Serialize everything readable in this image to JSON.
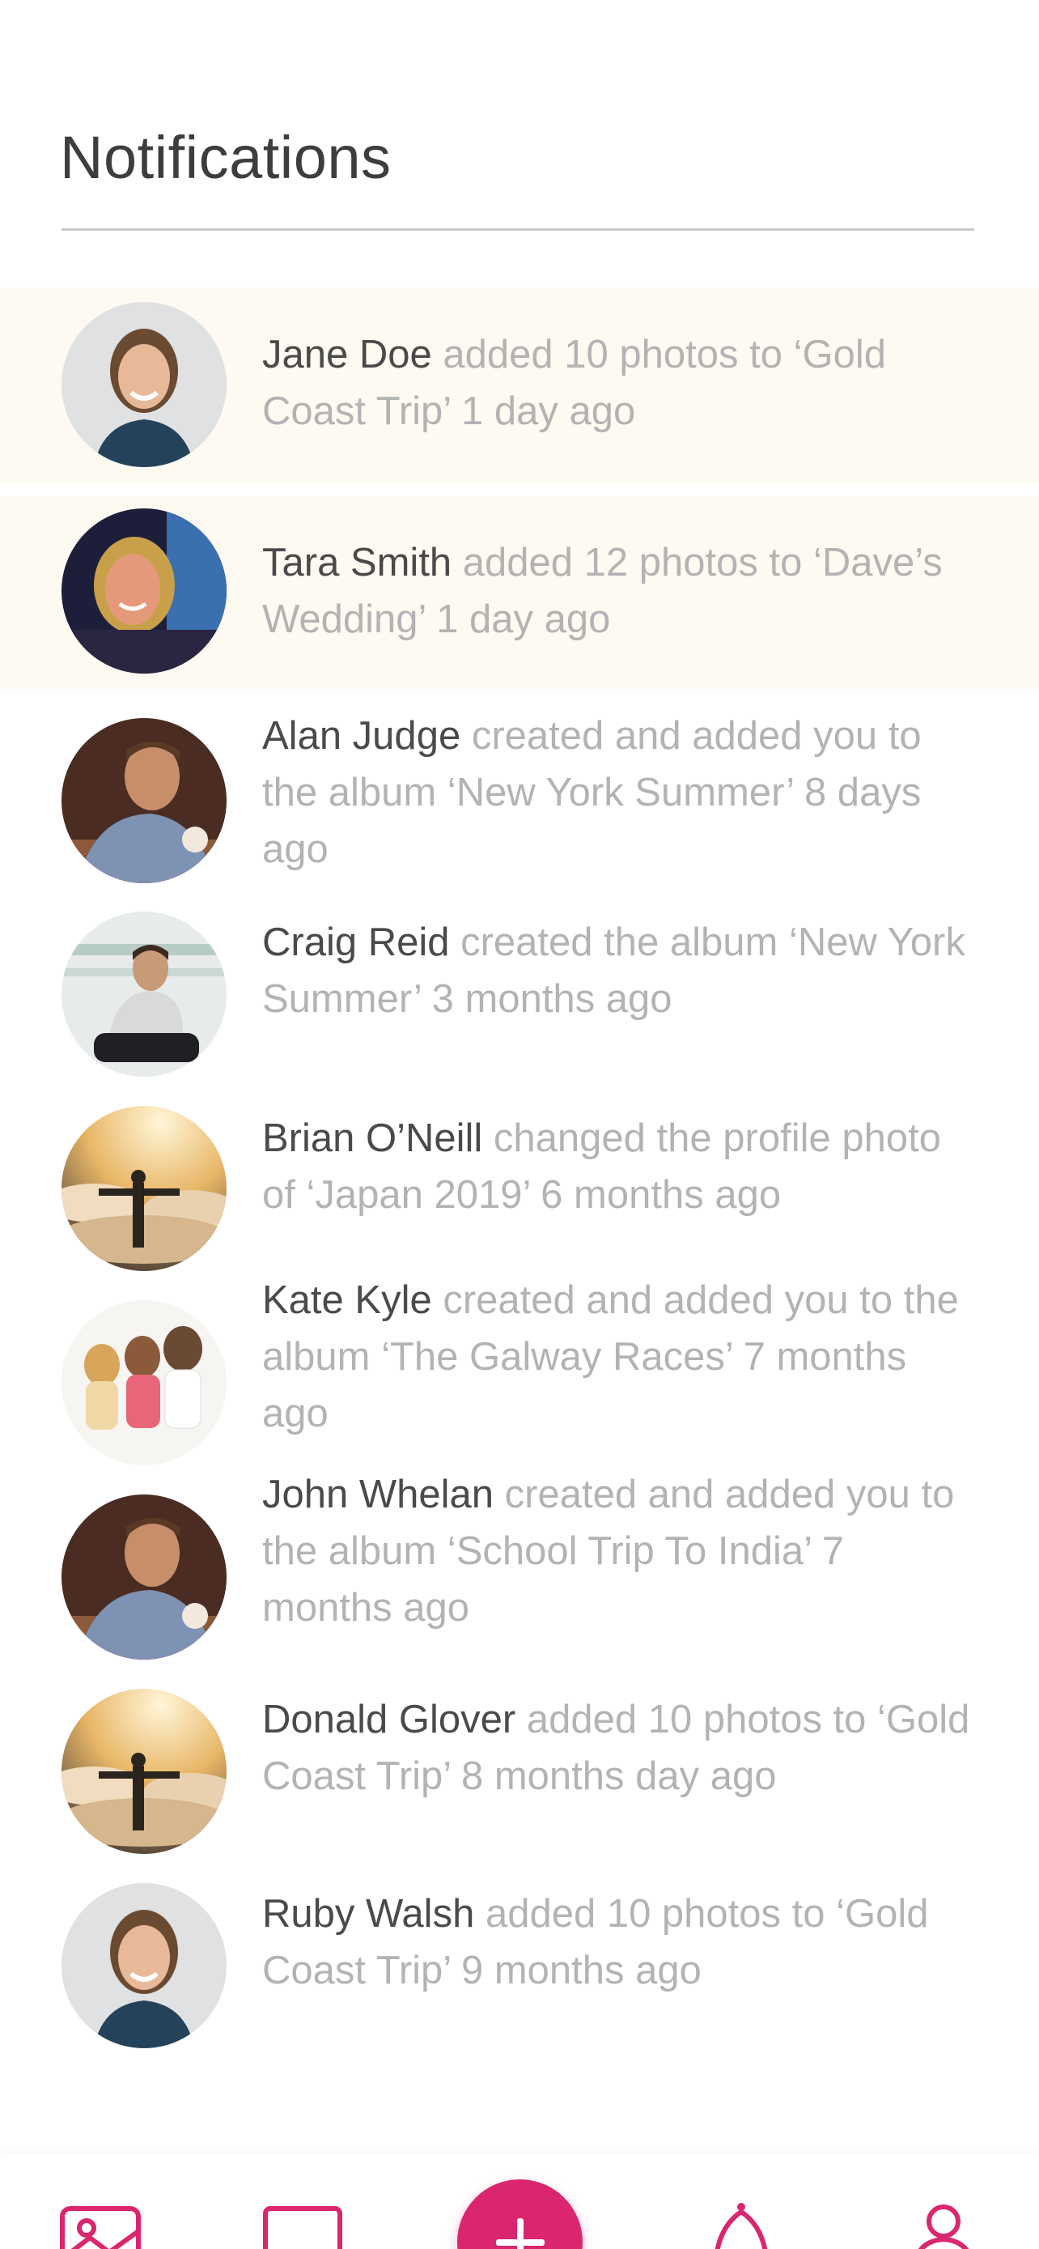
{
  "header": {
    "title": "Notifications"
  },
  "notifications": [
    {
      "name": "Jane Doe",
      "message": " added 10 photos to ‘Gold Coast Trip’ 1 day ago",
      "unread": true,
      "avatar": "woman-smiling-avatar"
    },
    {
      "name": "Tara Smith",
      "message": " added 12 photos to ‘Dave’s Wedding’ 1 day ago",
      "unread": true,
      "avatar": "woman-neon-light-avatar"
    },
    {
      "name": "Alan Judge",
      "message": " created and added you to the album ‘New York Summer’ 8 days ago",
      "unread": false,
      "avatar": "man-blue-shirt-avatar"
    },
    {
      "name": "Craig Reid",
      "message": " created the album ‘New York Summer’ 3 months ago",
      "unread": false,
      "avatar": "man-sitting-avatar"
    },
    {
      "name": "Brian O’Neill",
      "message": " changed the profile photo of ‘Japan 2019’ 6 months ago",
      "unread": false,
      "avatar": "person-on-clouds-avatar"
    },
    {
      "name": "Kate Kyle",
      "message": " created and added you to the album ‘The Galway Races’ 7 months ago",
      "unread": false,
      "avatar": "three-women-avatar"
    },
    {
      "name": "John Whelan",
      "message": " created and added you to the album ‘School Trip To India’ 7 months ago",
      "unread": false,
      "avatar": "man-blue-shirt-avatar"
    },
    {
      "name": "Donald Glover",
      "message": " added 10 photos to ‘Gold Coast Trip’ 8 months day ago",
      "unread": false,
      "avatar": "person-on-clouds-avatar"
    },
    {
      "name": "Ruby Walsh",
      "message": " added 10 photos to ‘Gold Coast Trip’ 9 months  ago",
      "unread": false,
      "avatar": "woman-smiling-avatar"
    }
  ],
  "tabbar": {
    "items": [
      {
        "icon": "photos-icon"
      },
      {
        "icon": "album-icon"
      },
      {
        "icon": "add-icon"
      },
      {
        "icon": "notifications-bell-icon"
      },
      {
        "icon": "profile-icon"
      }
    ],
    "accent": "#d9266f"
  }
}
